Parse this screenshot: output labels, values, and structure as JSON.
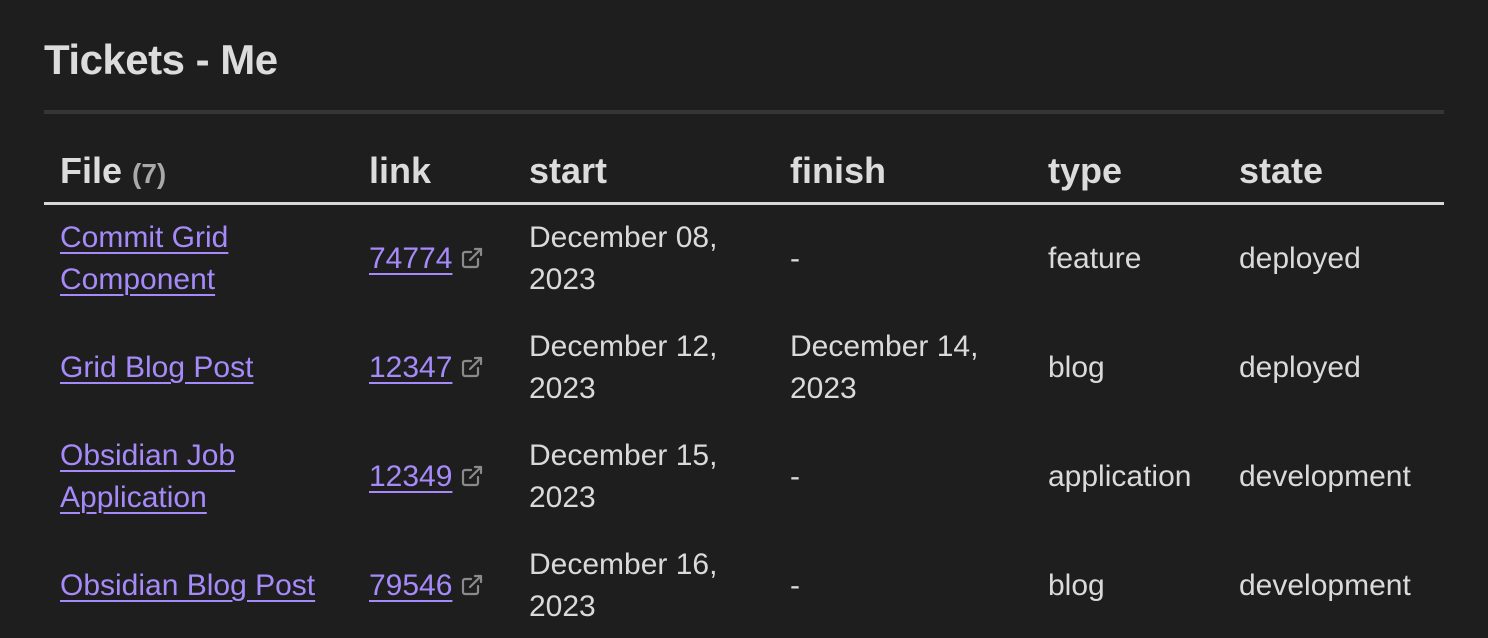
{
  "title": "Tickets - Me",
  "table": {
    "headers": {
      "file": "File",
      "file_count": "(7)",
      "link": "link",
      "start": "start",
      "finish": "finish",
      "type": "type",
      "state": "state"
    },
    "rows": [
      {
        "file_line1": "Commit Grid",
        "file_line2": "Component",
        "link": "74774",
        "start_line1": "December 08,",
        "start_line2": "2023",
        "finish_line1": "-",
        "finish_line2": "",
        "type": "feature",
        "state": "deployed"
      },
      {
        "file_line1": "Grid Blog Post",
        "file_line2": "",
        "link": "12347",
        "start_line1": "December 12,",
        "start_line2": "2023",
        "finish_line1": "December 14,",
        "finish_line2": "2023",
        "type": "blog",
        "state": "deployed"
      },
      {
        "file_line1": "Obsidian Job",
        "file_line2": "Application",
        "link": "12349",
        "start_line1": "December 15,",
        "start_line2": "2023",
        "finish_line1": "-",
        "finish_line2": "",
        "type": "application",
        "state": "development"
      },
      {
        "file_line1": "Obsidian Blog Post",
        "file_line2": "",
        "link": "79546",
        "start_line1": "December 16,",
        "start_line2": "2023",
        "finish_line1": "-",
        "finish_line2": "",
        "type": "blog",
        "state": "development"
      }
    ]
  },
  "colors": {
    "background": "#1e1e1e",
    "text": "#dadada",
    "link": "#a68af9",
    "muted": "#a9a9a9"
  },
  "icons": {
    "external_link": "external-link-icon"
  }
}
